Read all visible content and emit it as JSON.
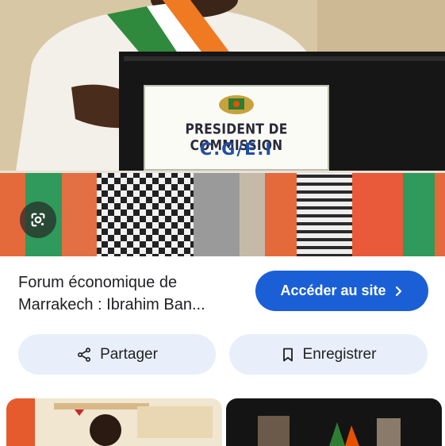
{
  "image": {
    "sign_title": "PRESIDENT DE COMMISSION",
    "sign_subtitle": "C.G/E.I"
  },
  "lens_button": {
    "icon": "google-lens-icon"
  },
  "result": {
    "title_line1": "Forum économique de",
    "title_line2": "Marrakech : Ibrahim Ban...",
    "visit_label": "Accéder au site",
    "visit_icon": "chevron-right-icon"
  },
  "actions": {
    "share_label": "Partager",
    "share_icon": "share-icon",
    "save_label": "Enregistrer",
    "save_icon": "bookmark-icon"
  },
  "colors": {
    "primary_button": "#1a5fd6",
    "tonal_button": "#e8effa",
    "text": "#202124"
  }
}
